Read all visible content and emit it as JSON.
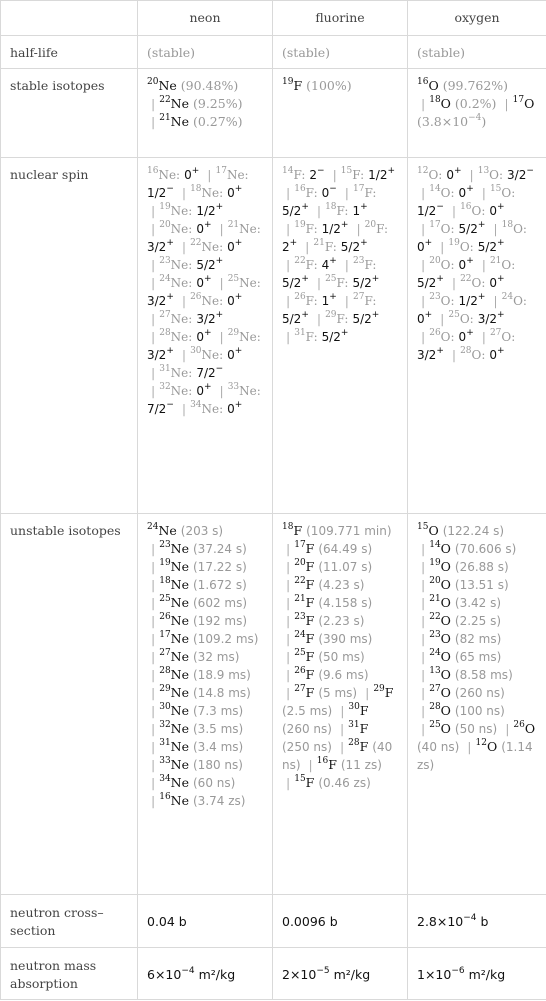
{
  "columns": [
    "neon",
    "fluorine",
    "oxygen"
  ],
  "rows": {
    "half_life": {
      "label": "half-life",
      "values": [
        "(stable)",
        "(stable)",
        "(stable)"
      ]
    },
    "stable_isotopes": {
      "label": "stable isotopes",
      "values": [
        [
          {
            "iso": "20",
            "el": "Ne",
            "val": "(90.48%)"
          },
          {
            "iso": "22",
            "el": "Ne",
            "val": "(9.25%)"
          },
          {
            "iso": "21",
            "el": "Ne",
            "val": "(0.27%)"
          }
        ],
        [
          {
            "iso": "19",
            "el": "F",
            "val": "(100%)"
          }
        ],
        [
          {
            "iso": "16",
            "el": "O",
            "val": "(99.762%)"
          },
          {
            "iso": "18",
            "el": "O",
            "val": "(0.2%)"
          },
          {
            "iso": "17",
            "el": "O",
            "val": "(3.8×10",
            "exp": "−4",
            "tail": ")"
          }
        ]
      ]
    },
    "nuclear_spin": {
      "label": "nuclear spin",
      "values": [
        [
          [
            "16",
            "Ne",
            "0",
            "+"
          ],
          [
            "17",
            "Ne",
            "1/2",
            "−"
          ],
          [
            "18",
            "Ne",
            "0",
            "+"
          ],
          [
            "19",
            "Ne",
            "1/2",
            "+"
          ],
          [
            "20",
            "Ne",
            "0",
            "+"
          ],
          [
            "21",
            "Ne",
            "3/2",
            "+"
          ],
          [
            "22",
            "Ne",
            "0",
            "+"
          ],
          [
            "23",
            "Ne",
            "5/2",
            "+"
          ],
          [
            "24",
            "Ne",
            "0",
            "+"
          ],
          [
            "25",
            "Ne",
            "3/2",
            "+"
          ],
          [
            "26",
            "Ne",
            "0",
            "+"
          ],
          [
            "27",
            "Ne",
            "3/2",
            "+"
          ],
          [
            "28",
            "Ne",
            "0",
            "+"
          ],
          [
            "29",
            "Ne",
            "3/2",
            "+"
          ],
          [
            "30",
            "Ne",
            "0",
            "+"
          ],
          [
            "31",
            "Ne",
            "7/2",
            "−"
          ],
          [
            "32",
            "Ne",
            "0",
            "+"
          ],
          [
            "33",
            "Ne",
            "7/2",
            "−"
          ],
          [
            "34",
            "Ne",
            "0",
            "+"
          ]
        ],
        [
          [
            "14",
            "F",
            "2",
            "−"
          ],
          [
            "15",
            "F",
            "1/2",
            "+"
          ],
          [
            "16",
            "F",
            "0",
            "−"
          ],
          [
            "17",
            "F",
            "5/2",
            "+"
          ],
          [
            "18",
            "F",
            "1",
            "+"
          ],
          [
            "19",
            "F",
            "1/2",
            "+"
          ],
          [
            "20",
            "F",
            "2",
            "+"
          ],
          [
            "21",
            "F",
            "5/2",
            "+"
          ],
          [
            "22",
            "F",
            "4",
            "+"
          ],
          [
            "23",
            "F",
            "5/2",
            "+"
          ],
          [
            "25",
            "F",
            "5/2",
            "+"
          ],
          [
            "26",
            "F",
            "1",
            "+"
          ],
          [
            "27",
            "F",
            "5/2",
            "+"
          ],
          [
            "29",
            "F",
            "5/2",
            "+"
          ],
          [
            "31",
            "F",
            "5/2",
            "+"
          ]
        ],
        [
          [
            "12",
            "O",
            "0",
            "+"
          ],
          [
            "13",
            "O",
            "3/2",
            "−"
          ],
          [
            "14",
            "O",
            "0",
            "+"
          ],
          [
            "15",
            "O",
            "1/2",
            "−"
          ],
          [
            "16",
            "O",
            "0",
            "+"
          ],
          [
            "17",
            "O",
            "5/2",
            "+"
          ],
          [
            "18",
            "O",
            "0",
            "+"
          ],
          [
            "19",
            "O",
            "5/2",
            "+"
          ],
          [
            "20",
            "O",
            "0",
            "+"
          ],
          [
            "21",
            "O",
            "5/2",
            "+"
          ],
          [
            "22",
            "O",
            "0",
            "+"
          ],
          [
            "23",
            "O",
            "1/2",
            "+"
          ],
          [
            "24",
            "O",
            "0",
            "+"
          ],
          [
            "25",
            "O",
            "3/2",
            "+"
          ],
          [
            "26",
            "O",
            "0",
            "+"
          ],
          [
            "27",
            "O",
            "3/2",
            "+"
          ],
          [
            "28",
            "O",
            "0",
            "+"
          ]
        ]
      ]
    },
    "unstable_isotopes": {
      "label": "unstable isotopes",
      "values": [
        [
          [
            "24",
            "Ne",
            "203 s"
          ],
          [
            "23",
            "Ne",
            "37.24 s"
          ],
          [
            "19",
            "Ne",
            "17.22 s"
          ],
          [
            "18",
            "Ne",
            "1.672 s"
          ],
          [
            "25",
            "Ne",
            "602 ms"
          ],
          [
            "26",
            "Ne",
            "192 ms"
          ],
          [
            "17",
            "Ne",
            "109.2 ms"
          ],
          [
            "27",
            "Ne",
            "32 ms"
          ],
          [
            "28",
            "Ne",
            "18.9 ms"
          ],
          [
            "29",
            "Ne",
            "14.8 ms"
          ],
          [
            "30",
            "Ne",
            "7.3 ms"
          ],
          [
            "32",
            "Ne",
            "3.5 ms"
          ],
          [
            "31",
            "Ne",
            "3.4 ms"
          ],
          [
            "33",
            "Ne",
            "180 ns"
          ],
          [
            "34",
            "Ne",
            "60 ns"
          ],
          [
            "16",
            "Ne",
            "3.74 zs"
          ]
        ],
        [
          [
            "18",
            "F",
            "109.771 min"
          ],
          [
            "17",
            "F",
            "64.49 s"
          ],
          [
            "20",
            "F",
            "11.07 s"
          ],
          [
            "22",
            "F",
            "4.23 s"
          ],
          [
            "21",
            "F",
            "4.158 s"
          ],
          [
            "23",
            "F",
            "2.23 s"
          ],
          [
            "24",
            "F",
            "390 ms"
          ],
          [
            "25",
            "F",
            "50 ms"
          ],
          [
            "26",
            "F",
            "9.6 ms"
          ],
          [
            "27",
            "F",
            "5 ms"
          ],
          [
            "29",
            "F",
            "2.5 ms"
          ],
          [
            "30",
            "F",
            "260 ns"
          ],
          [
            "31",
            "F",
            "250 ns"
          ],
          [
            "28",
            "F",
            "40 ns"
          ],
          [
            "16",
            "F",
            "11 zs"
          ],
          [
            "15",
            "F",
            "0.46 zs"
          ]
        ],
        [
          [
            "15",
            "O",
            "122.24 s"
          ],
          [
            "14",
            "O",
            "70.606 s"
          ],
          [
            "19",
            "O",
            "26.88 s"
          ],
          [
            "20",
            "O",
            "13.51 s"
          ],
          [
            "21",
            "O",
            "3.42 s"
          ],
          [
            "22",
            "O",
            "2.25 s"
          ],
          [
            "23",
            "O",
            "82 ms"
          ],
          [
            "24",
            "O",
            "65 ms"
          ],
          [
            "13",
            "O",
            "8.58 ms"
          ],
          [
            "27",
            "O",
            "260 ns"
          ],
          [
            "28",
            "O",
            "100 ns"
          ],
          [
            "25",
            "O",
            "50 ns"
          ],
          [
            "26",
            "O",
            "40 ns"
          ],
          [
            "12",
            "O",
            "1.14 zs"
          ]
        ]
      ]
    },
    "neutron_cross_section": {
      "label": "neutron cross–section",
      "values": [
        {
          "mant": "0.04 b"
        },
        {
          "mant": "0.0096 b"
        },
        {
          "mant": "2.8×10",
          "exp": "−4",
          "unit": " b"
        }
      ]
    },
    "neutron_mass_absorption": {
      "label": "neutron mass absorption",
      "values": [
        {
          "mant": "6×10",
          "exp": "−4",
          "unit": " m²/kg"
        },
        {
          "mant": "2×10",
          "exp": "−5",
          "unit": " m²/kg"
        },
        {
          "mant": "1×10",
          "exp": "−6",
          "unit": " m²/kg"
        }
      ]
    }
  }
}
